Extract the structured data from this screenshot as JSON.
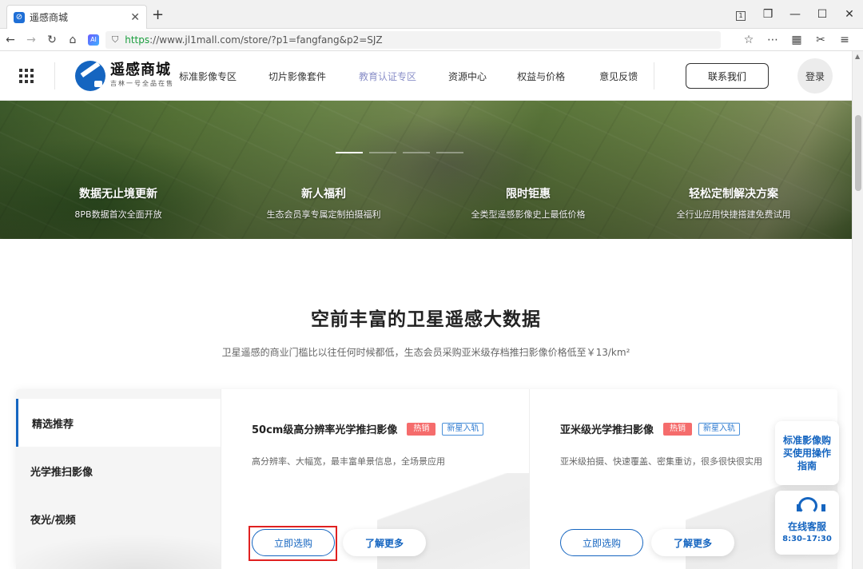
{
  "browser": {
    "tab_title": "遥感商城",
    "favicon_letter": "⊘",
    "new_tab": "+",
    "url_scheme": "https",
    "url_rest": "://www.jl1mall.com/store/?p1=fangfang&p2=SJZ",
    "window_controls": [
      "1",
      "❒",
      "—",
      "☐",
      "✕"
    ],
    "ai_label": "AI"
  },
  "header": {
    "logo_title": "遥感商城",
    "logo_sub": "吉林一号全品在售",
    "nav": [
      "标准影像专区",
      "切片影像套件",
      "教育认证专区",
      "资源中心",
      "权益与价格",
      "意见反馈"
    ],
    "contact": "联系我们",
    "login": "登录"
  },
  "hero": {
    "features": [
      {
        "title": "数据无止境更新",
        "desc": "8PB数据首次全面开放"
      },
      {
        "title": "新人福利",
        "desc": "生态会员享专属定制拍摄福利"
      },
      {
        "title": "限时钜惠",
        "desc": "全类型遥感影像史上最低价格"
      },
      {
        "title": "轻松定制解决方案",
        "desc": "全行业应用快捷搭建免费试用"
      }
    ]
  },
  "section": {
    "title": "空前丰富的卫星遥感大数据",
    "subtitle": "卫星遥感的商业门槛比以往任何时候都低，生态会员采购亚米级存档推扫影像价格低至￥13/km²"
  },
  "side_tabs": [
    "精选推荐",
    "光学推扫影像",
    "夜光/视频"
  ],
  "products": [
    {
      "title": "50cm级高分辨率光学推扫影像",
      "tag_hot": "热销",
      "tag_new": "新星入轨",
      "desc": "高分辨率、大幅宽，最丰富单景信息，全场景应用",
      "buy": "立即选购",
      "more": "了解更多"
    },
    {
      "title": "亚米级光学推扫影像",
      "tag_hot": "热销",
      "tag_new": "新星入轨",
      "desc": "亚米级拍摄、快速覆盖、密集重访，很多很快很实用",
      "buy": "立即选购",
      "more": "了解更多"
    }
  ],
  "floating": {
    "guide": "标准影像购买使用操作指南",
    "service_title": "在线客服",
    "service_hours": "8:30–17:30"
  }
}
